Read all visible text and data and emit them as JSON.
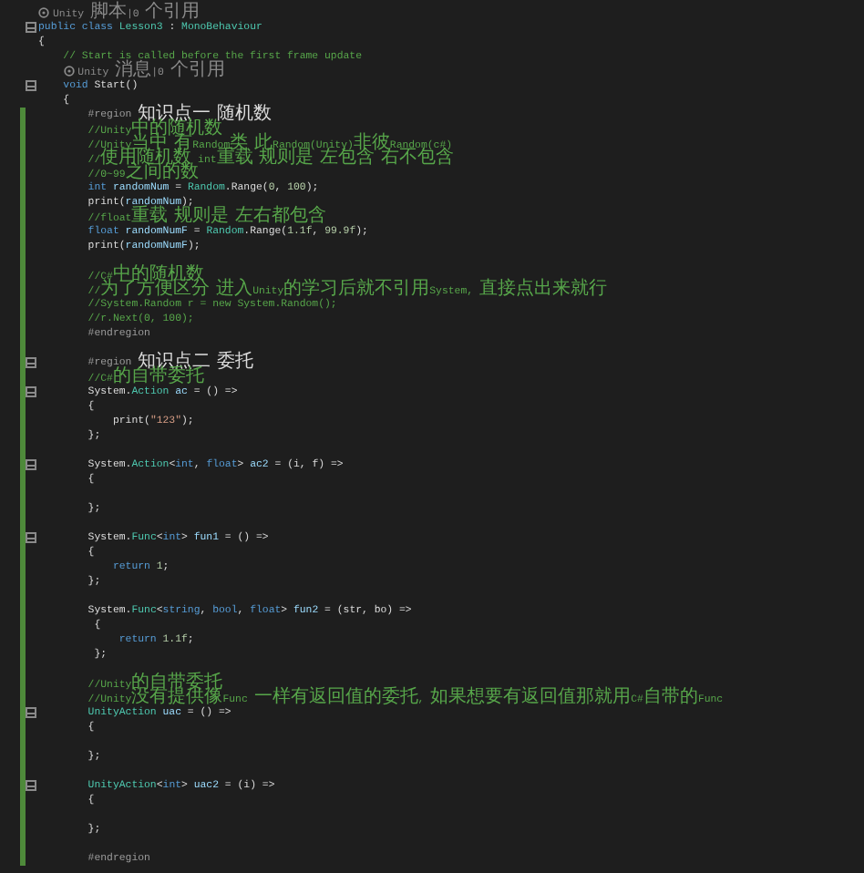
{
  "editor": {
    "lines": [
      {
        "modified": false,
        "fold": false,
        "segments": [
          {
            "kind": "lens",
            "text": "Unity 脚本|0 个引用"
          }
        ]
      },
      {
        "modified": false,
        "fold": true,
        "segments": [
          {
            "kind": "keyword",
            "text": "public class "
          },
          {
            "kind": "type",
            "text": "Lesson3"
          },
          {
            "kind": "plain",
            "text": " : "
          },
          {
            "kind": "type",
            "text": "MonoBehaviour"
          }
        ]
      },
      {
        "modified": false,
        "fold": false,
        "segments": [
          {
            "kind": "plain",
            "text": "{"
          }
        ]
      },
      {
        "modified": false,
        "fold": false,
        "segments": [
          {
            "kind": "comment",
            "text": "    // Start is called before the first frame update"
          }
        ]
      },
      {
        "modified": false,
        "fold": false,
        "segments": [
          {
            "kind": "lens",
            "text": "    Unity 消息|0 个引用"
          }
        ]
      },
      {
        "modified": false,
        "fold": true,
        "segments": [
          {
            "kind": "keyword",
            "text": "    void "
          },
          {
            "kind": "plain",
            "text": "Start()"
          }
        ]
      },
      {
        "modified": false,
        "fold": false,
        "segments": [
          {
            "kind": "plain",
            "text": "    {"
          }
        ]
      },
      {
        "modified": true,
        "fold": false,
        "segments": [
          {
            "kind": "region",
            "text": "        #region "
          },
          {
            "kind": "plain",
            "text": "知识点一 随机数"
          }
        ]
      },
      {
        "modified": true,
        "fold": false,
        "segments": [
          {
            "kind": "comment",
            "text": "        //Unity中的随机数"
          }
        ]
      },
      {
        "modified": true,
        "fold": false,
        "segments": [
          {
            "kind": "comment",
            "text": "        //Unity当中 有Random类 此Random(Unity)非彼Random(c#)"
          }
        ]
      },
      {
        "modified": true,
        "fold": false,
        "segments": [
          {
            "kind": "comment",
            "text": "        //使用随机数 int重载 规则是 左包含 右不包含"
          }
        ]
      },
      {
        "modified": true,
        "fold": false,
        "segments": [
          {
            "kind": "comment",
            "text": "        //0~99之间的数"
          }
        ]
      },
      {
        "modified": true,
        "fold": false,
        "segments": [
          {
            "kind": "keyword",
            "text": "        int "
          },
          {
            "kind": "variable",
            "text": "randomNum"
          },
          {
            "kind": "plain",
            "text": " = "
          },
          {
            "kind": "type",
            "text": "Random"
          },
          {
            "kind": "plain",
            "text": ".Range("
          },
          {
            "kind": "number",
            "text": "0"
          },
          {
            "kind": "plain",
            "text": ", "
          },
          {
            "kind": "number",
            "text": "100"
          },
          {
            "kind": "plain",
            "text": ");"
          }
        ]
      },
      {
        "modified": true,
        "fold": false,
        "segments": [
          {
            "kind": "plain",
            "text": "        print("
          },
          {
            "kind": "variable",
            "text": "randomNum"
          },
          {
            "kind": "plain",
            "text": ");"
          }
        ]
      },
      {
        "modified": true,
        "fold": false,
        "segments": [
          {
            "kind": "comment",
            "text": "        //float重载 规则是 左右都包含"
          }
        ]
      },
      {
        "modified": true,
        "fold": false,
        "segments": [
          {
            "kind": "keyword",
            "text": "        float "
          },
          {
            "kind": "variable",
            "text": "randomNumF"
          },
          {
            "kind": "plain",
            "text": " = "
          },
          {
            "kind": "type",
            "text": "Random"
          },
          {
            "kind": "plain",
            "text": ".Range("
          },
          {
            "kind": "number",
            "text": "1.1f"
          },
          {
            "kind": "plain",
            "text": ", "
          },
          {
            "kind": "number",
            "text": "99.9f"
          },
          {
            "kind": "plain",
            "text": ");"
          }
        ]
      },
      {
        "modified": true,
        "fold": false,
        "segments": [
          {
            "kind": "plain",
            "text": "        print("
          },
          {
            "kind": "variable",
            "text": "randomNumF"
          },
          {
            "kind": "plain",
            "text": ");"
          }
        ]
      },
      {
        "modified": true,
        "fold": false
      },
      {
        "modified": true,
        "fold": false,
        "segments": [
          {
            "kind": "comment",
            "text": "        //C#中的随机数"
          }
        ]
      },
      {
        "modified": true,
        "fold": false,
        "segments": [
          {
            "kind": "comment",
            "text": "        //为了方便区分 进入Unity的学习后就不引用System, 直接点出来就行"
          }
        ]
      },
      {
        "modified": true,
        "fold": false,
        "segments": [
          {
            "kind": "comment",
            "text": "        //System.Random r = new System.Random();"
          }
        ]
      },
      {
        "modified": true,
        "fold": false,
        "segments": [
          {
            "kind": "comment",
            "text": "        //r.Next(0, 100);"
          }
        ]
      },
      {
        "modified": true,
        "fold": false,
        "segments": [
          {
            "kind": "region",
            "text": "        #endregion"
          }
        ]
      },
      {
        "modified": true,
        "fold": false
      },
      {
        "modified": true,
        "fold": true,
        "segments": [
          {
            "kind": "region",
            "text": "        #region "
          },
          {
            "kind": "plain",
            "text": "知识点二 委托"
          }
        ]
      },
      {
        "modified": true,
        "fold": false,
        "segments": [
          {
            "kind": "comment",
            "text": "        //C#的自带委托"
          }
        ]
      },
      {
        "modified": true,
        "fold": true,
        "segments": [
          {
            "kind": "plain",
            "text": "        System."
          },
          {
            "kind": "type",
            "text": "Action"
          },
          {
            "kind": "variable",
            "text": " ac"
          },
          {
            "kind": "plain",
            "text": " = () =>"
          }
        ]
      },
      {
        "modified": true,
        "fold": false,
        "segments": [
          {
            "kind": "plain",
            "text": "        {"
          }
        ]
      },
      {
        "modified": true,
        "fold": false,
        "segments": [
          {
            "kind": "plain",
            "text": "            print("
          },
          {
            "kind": "string",
            "text": "\"123\""
          },
          {
            "kind": "plain",
            "text": ");"
          }
        ]
      },
      {
        "modified": true,
        "fold": false,
        "segments": [
          {
            "kind": "plain",
            "text": "        };"
          }
        ]
      },
      {
        "modified": true,
        "fold": false
      },
      {
        "modified": true,
        "fold": true,
        "segments": [
          {
            "kind": "plain",
            "text": "        System."
          },
          {
            "kind": "type",
            "text": "Action"
          },
          {
            "kind": "plain",
            "text": "<"
          },
          {
            "kind": "keyword",
            "text": "int"
          },
          {
            "kind": "plain",
            "text": ", "
          },
          {
            "kind": "keyword",
            "text": "float"
          },
          {
            "kind": "plain",
            "text": "> "
          },
          {
            "kind": "variable",
            "text": "ac2"
          },
          {
            "kind": "plain",
            "text": " = (i, f) =>"
          }
        ]
      },
      {
        "modified": true,
        "fold": false,
        "segments": [
          {
            "kind": "plain",
            "text": "        {"
          }
        ]
      },
      {
        "modified": true,
        "fold": false
      },
      {
        "modified": true,
        "fold": false,
        "segments": [
          {
            "kind": "plain",
            "text": "        };"
          }
        ]
      },
      {
        "modified": true,
        "fold": false
      },
      {
        "modified": true,
        "fold": true,
        "segments": [
          {
            "kind": "plain",
            "text": "        System."
          },
          {
            "kind": "type",
            "text": "Func"
          },
          {
            "kind": "plain",
            "text": "<"
          },
          {
            "kind": "keyword",
            "text": "int"
          },
          {
            "kind": "plain",
            "text": "> "
          },
          {
            "kind": "variable",
            "text": "fun1"
          },
          {
            "kind": "plain",
            "text": " = () =>"
          }
        ]
      },
      {
        "modified": true,
        "fold": false,
        "segments": [
          {
            "kind": "plain",
            "text": "        {"
          }
        ]
      },
      {
        "modified": true,
        "fold": false,
        "segments": [
          {
            "kind": "keyword",
            "text": "            return "
          },
          {
            "kind": "number",
            "text": "1"
          },
          {
            "kind": "plain",
            "text": ";"
          }
        ]
      },
      {
        "modified": true,
        "fold": false,
        "segments": [
          {
            "kind": "plain",
            "text": "        };"
          }
        ]
      },
      {
        "modified": true,
        "fold": false
      },
      {
        "modified": true,
        "fold": false,
        "segments": [
          {
            "kind": "plain",
            "text": "        System."
          },
          {
            "kind": "type",
            "text": "Func"
          },
          {
            "kind": "plain",
            "text": "<"
          },
          {
            "kind": "keyword",
            "text": "string"
          },
          {
            "kind": "plain",
            "text": ", "
          },
          {
            "kind": "keyword",
            "text": "bool"
          },
          {
            "kind": "plain",
            "text": ", "
          },
          {
            "kind": "keyword",
            "text": "float"
          },
          {
            "kind": "plain",
            "text": "> "
          },
          {
            "kind": "variable",
            "text": "fun2"
          },
          {
            "kind": "plain",
            "text": " = (str, bo) =>"
          }
        ]
      },
      {
        "modified": true,
        "fold": false,
        "segments": [
          {
            "kind": "plain",
            "text": "         {"
          }
        ]
      },
      {
        "modified": true,
        "fold": false,
        "segments": [
          {
            "kind": "keyword",
            "text": "             return "
          },
          {
            "kind": "number",
            "text": "1.1f"
          },
          {
            "kind": "plain",
            "text": ";"
          }
        ]
      },
      {
        "modified": true,
        "fold": false,
        "segments": [
          {
            "kind": "plain",
            "text": "         };"
          }
        ]
      },
      {
        "modified": true,
        "fold": false
      },
      {
        "modified": true,
        "fold": false,
        "segments": [
          {
            "kind": "comment",
            "text": "        //Unity的自带委托"
          }
        ]
      },
      {
        "modified": true,
        "fold": false,
        "segments": [
          {
            "kind": "comment",
            "text": "        //Unity没有提供像Func 一样有返回值的委托, 如果想要有返回值那就用C#自带的Func"
          }
        ]
      },
      {
        "modified": true,
        "fold": true,
        "segments": [
          {
            "kind": "type",
            "text": "        UnityAction"
          },
          {
            "kind": "variable",
            "text": " uac"
          },
          {
            "kind": "plain",
            "text": " = () =>"
          }
        ]
      },
      {
        "modified": true,
        "fold": false,
        "segments": [
          {
            "kind": "plain",
            "text": "        {"
          }
        ]
      },
      {
        "modified": true,
        "fold": false
      },
      {
        "modified": true,
        "fold": false,
        "segments": [
          {
            "kind": "plain",
            "text": "        };"
          }
        ]
      },
      {
        "modified": true,
        "fold": false
      },
      {
        "modified": true,
        "fold": true,
        "segments": [
          {
            "kind": "type",
            "text": "        UnityAction"
          },
          {
            "kind": "plain",
            "text": "<"
          },
          {
            "kind": "keyword",
            "text": "int"
          },
          {
            "kind": "plain",
            "text": "> "
          },
          {
            "kind": "variable",
            "text": "uac2"
          },
          {
            "kind": "plain",
            "text": " = (i) =>"
          }
        ]
      },
      {
        "modified": true,
        "fold": false,
        "segments": [
          {
            "kind": "plain",
            "text": "        {"
          }
        ]
      },
      {
        "modified": true,
        "fold": false
      },
      {
        "modified": true,
        "fold": false,
        "segments": [
          {
            "kind": "plain",
            "text": "        };"
          }
        ]
      },
      {
        "modified": true,
        "fold": false
      },
      {
        "modified": true,
        "fold": false,
        "segments": [
          {
            "kind": "region",
            "text": "        #endregion"
          }
        ]
      }
    ]
  }
}
